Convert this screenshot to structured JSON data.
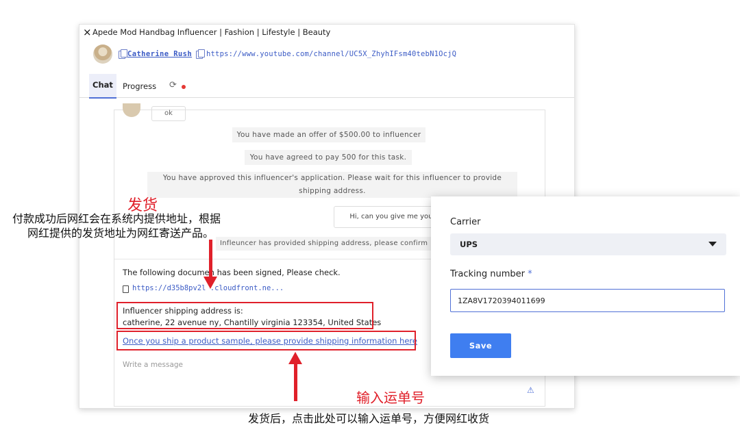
{
  "window": {
    "title": "Apede Mod Handbag Influencer | Fashion | Lifestyle | Beauty",
    "close_icon": "×"
  },
  "influencer": {
    "name": "Catherine Rush",
    "channel_url": "https://www.youtube.com/channel/UC5X_ZhyhIFsm40tebN1OcjQ"
  },
  "tabs": [
    {
      "label": "Chat",
      "active": true
    },
    {
      "label": "Progress",
      "active": false
    }
  ],
  "icons": {
    "refresh": "⟳",
    "warning": "⚠"
  },
  "chat": {
    "previous_bubble": "ok",
    "system_messages": [
      "You have made an offer of $500.00 to influencer",
      "You have agreed to pay 500 for this task.",
      "You have approved this influencer's application. Please wait for this influencer to provide shipping address.",
      "Infleuncer has provided shipping address, please confirm"
    ],
    "user_bubble": "Hi, can you give me your",
    "signed_notice": "The following documen has been signed, Please check.",
    "file_link": "https://d35b8pv2l   .cloudfront.ne...",
    "address_label": "Influencer shipping address is:",
    "address_value": "catherine, 22 avenue ny, Chantilly virginia 123354, United States",
    "ship_link": "Once you ship a product sample, please provide shipping information here",
    "message_placeholder": "Write a message"
  },
  "annotations": {
    "ship_title": "发货",
    "ship_desc_line1": "付款成功后网红会在系统内提供地址，根据",
    "ship_desc_line2": "网红提供的发货地址为网红寄送产品。",
    "input_title": "输入运单号",
    "input_desc": "发货后，点击此处可以输入运单号，方便网红收货",
    "accent_color": "#e0202a"
  },
  "shipping_form": {
    "carrier_label": "Carrier",
    "carrier_value": "UPS",
    "tracking_label": "Tracking number",
    "required_mark": "*",
    "tracking_value": "1ZA8V1720394011699",
    "save_label": "Save"
  },
  "colors": {
    "link": "#3b5bc5",
    "primary_button": "#3f7ef0",
    "status_dot": "#e53935"
  }
}
